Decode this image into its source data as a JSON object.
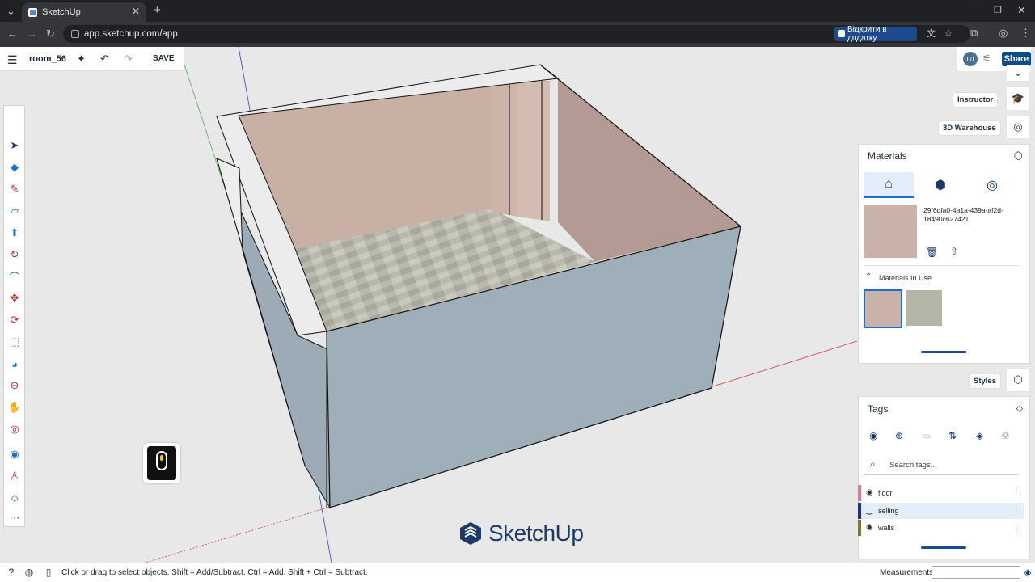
{
  "browser": {
    "tab_title": "SketchUp",
    "url": "app.sketchup.com/app",
    "open_in_app_label": "Відкрити в додатку"
  },
  "toolbar": {
    "file_name": "room_56",
    "save_label": "SAVE"
  },
  "header": {
    "avatar_initials": "ГЛ",
    "share_label": "Share"
  },
  "side_pills": {
    "instructor": "Instructor",
    "warehouse": "3D Warehouse",
    "styles": "Styles"
  },
  "materials": {
    "title": "Materials",
    "selected_name": "29f6dfa0-4a1a-439a-af2d-18490c627421",
    "in_use_label": "Materials In Use",
    "colors": {
      "wall": "#c9b3a8",
      "floor": "#b8b8ab"
    }
  },
  "tags": {
    "title": "Tags",
    "search_placeholder": "Search tags...",
    "items": [
      {
        "name": "floor",
        "color": "#e5749a",
        "visible": true
      },
      {
        "name": "selling",
        "color": "#1e2a9a",
        "visible": false
      },
      {
        "name": "walls",
        "color": "#7a7a2a",
        "visible": true
      }
    ]
  },
  "status": {
    "hint": "Click or drag to select objects. Shift = Add/Subtract. Ctrl = Add. Shift + Ctrl = Subtract.",
    "measurements_label": "Measurements"
  },
  "watermark": "SketchUp"
}
